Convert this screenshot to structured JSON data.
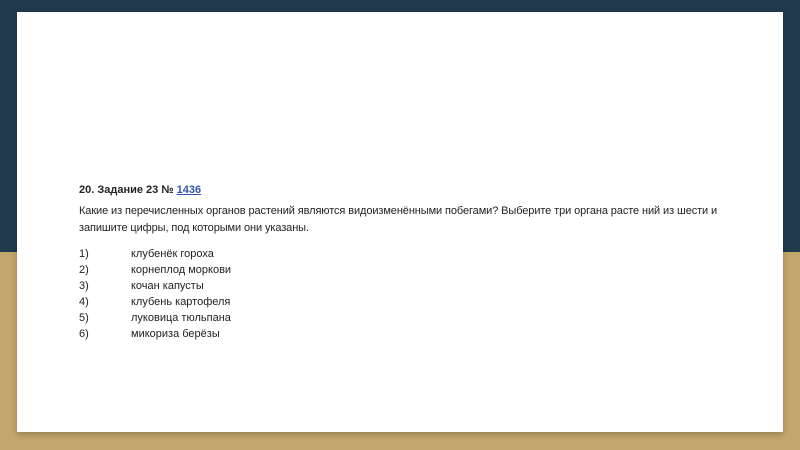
{
  "colors": {
    "background_top": "#223a4e",
    "background_bottom": "#c3a66c",
    "link": "#3557a8"
  },
  "task": {
    "heading_prefix": "20. Задание 23 № ",
    "link_text": "1436",
    "question": "Какие из перечисленных органов растений являются видоизменёнными побегами? Выберите три органа расте ний из шести и запишите цифры, под которыми они указаны.",
    "options": [
      {
        "num": "1)",
        "text": "клубенёк гороха"
      },
      {
        "num": "2)",
        "text": "корнеплод моркови"
      },
      {
        "num": "3)",
        "text": "кочан капусты"
      },
      {
        "num": "4)",
        "text": "клубень картофеля"
      },
      {
        "num": "5)",
        "text": "луковица тюльпана"
      },
      {
        "num": "6)",
        "text": "микориза берёзы"
      }
    ]
  }
}
